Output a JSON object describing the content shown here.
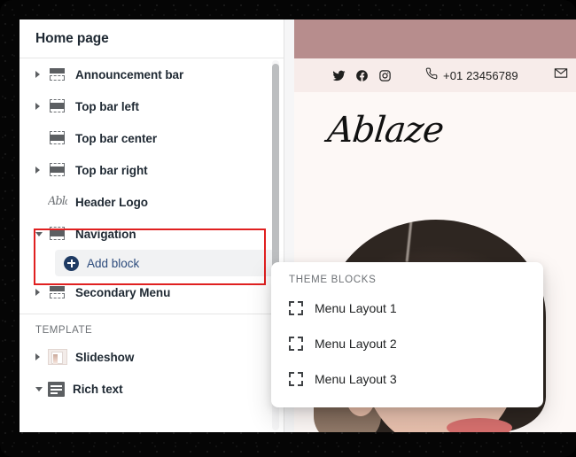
{
  "sidebar": {
    "page_title": "Home page",
    "sections": [
      {
        "label": "",
        "items": [
          {
            "label": "Announcement bar",
            "caret": "right",
            "icon": "block-bar-top-icon"
          },
          {
            "label": "Top bar left",
            "caret": "right",
            "icon": "block-bar-mid-icon"
          },
          {
            "label": "Top bar center",
            "caret": "none",
            "icon": "block-bar-mid-icon"
          },
          {
            "label": "Top bar right",
            "caret": "right",
            "icon": "block-bar-mid-icon"
          },
          {
            "label": "Header Logo",
            "caret": "none",
            "icon": "header-logo-icon"
          },
          {
            "label": "Navigation",
            "caret": "down",
            "icon": "block-bar-mid-icon"
          },
          {
            "label": "Secondary Menu",
            "caret": "right",
            "icon": "block-bar-bottom-icon"
          }
        ]
      },
      {
        "label": "TEMPLATE",
        "items": [
          {
            "label": "Slideshow",
            "caret": "right",
            "icon": "slideshow-icon"
          },
          {
            "label": "Rich text",
            "caret": "down",
            "icon": "rich-text-icon"
          }
        ]
      }
    ],
    "add_block_label": "Add block",
    "header_logo_glyph": "Abla"
  },
  "dropdown": {
    "title": "THEME BLOCKS",
    "items": [
      {
        "label": "Menu Layout 1"
      },
      {
        "label": "Menu Layout 2"
      },
      {
        "label": "Menu Layout 3"
      }
    ]
  },
  "preview": {
    "phone": "+01 23456789",
    "brand": "Ablaze",
    "social": [
      "twitter-icon",
      "facebook-icon",
      "instagram-icon"
    ],
    "colors": {
      "announcement_band": "#b78d8d",
      "top_bar_band": "#f7ecea",
      "page_background": "#fdf8f6"
    }
  },
  "annotation": {
    "color": "#e02020"
  }
}
